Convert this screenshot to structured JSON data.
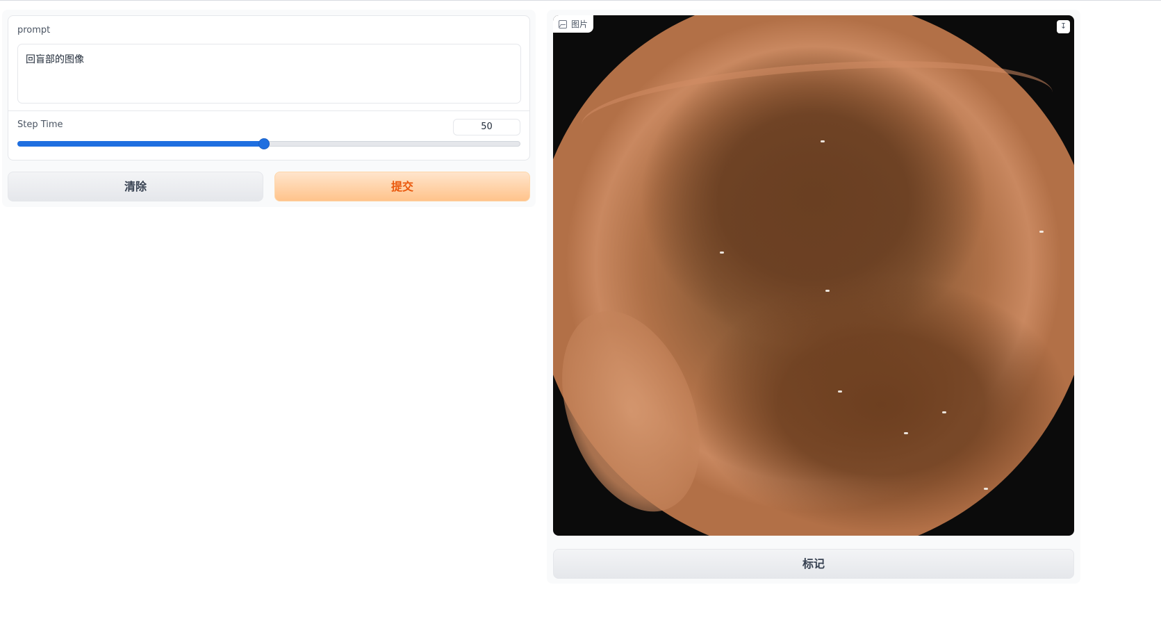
{
  "prompt": {
    "label": "prompt",
    "value": "回盲部的图像"
  },
  "step_time": {
    "label": "Step Time",
    "value": "50",
    "fraction": 0.49
  },
  "buttons": {
    "clear": "清除",
    "submit": "提交",
    "mark": "标记"
  },
  "image_panel": {
    "label": "图片",
    "download_icon": "download-icon",
    "image_icon": "image-icon"
  },
  "colors": {
    "accent": "#1f6fe0",
    "submit_text": "#ea580c",
    "submit_bg": "#ffc38b"
  }
}
